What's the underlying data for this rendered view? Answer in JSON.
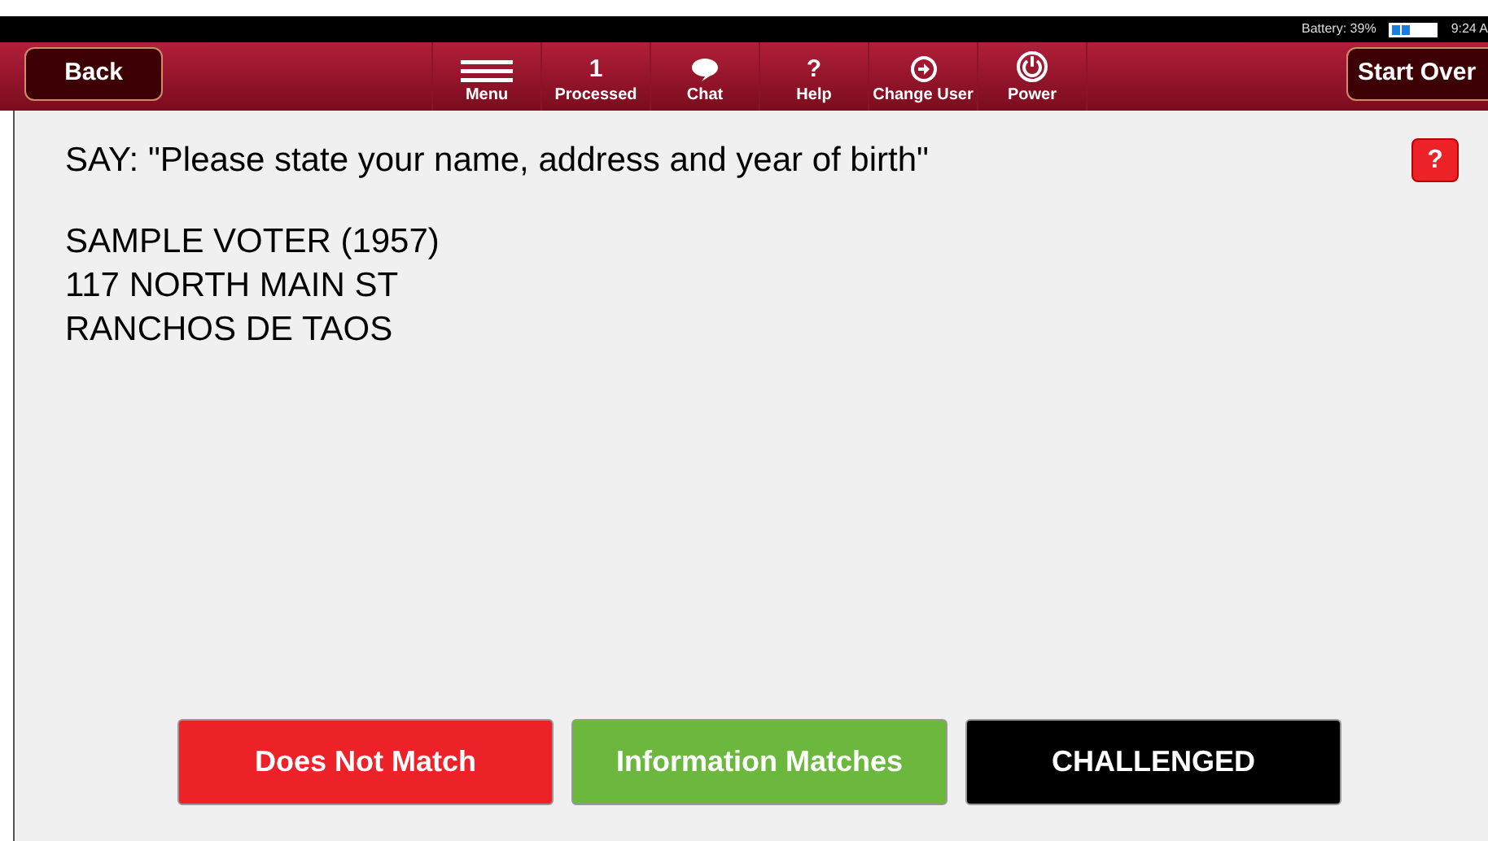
{
  "status_bar": {
    "battery": "Battery: 39%",
    "time": "9:24 A"
  },
  "toolbar": {
    "back": "Back",
    "start_over": "Start Over",
    "items": [
      {
        "kind": "menu",
        "label": "Menu"
      },
      {
        "kind": "text",
        "symbol": "1",
        "label": "Processed"
      },
      {
        "kind": "chat",
        "label": "Chat"
      },
      {
        "kind": "text",
        "symbol": "?",
        "label": "Help"
      },
      {
        "kind": "change-user",
        "label": "Change User"
      },
      {
        "kind": "power",
        "label": "Power"
      }
    ]
  },
  "prompt": "SAY: \"Please state your name, address and year of birth\"",
  "help_button": "?",
  "voter": [
    "SAMPLE VOTER (1957)",
    "117 NORTH MAIN ST",
    "RANCHOS DE TAOS"
  ],
  "actions": [
    {
      "label": "Does Not Match",
      "color": "#ec2228"
    },
    {
      "label": "Information Matches",
      "color": "#6cb83f"
    },
    {
      "label": "CHALLENGED",
      "color": "#000000"
    }
  ]
}
